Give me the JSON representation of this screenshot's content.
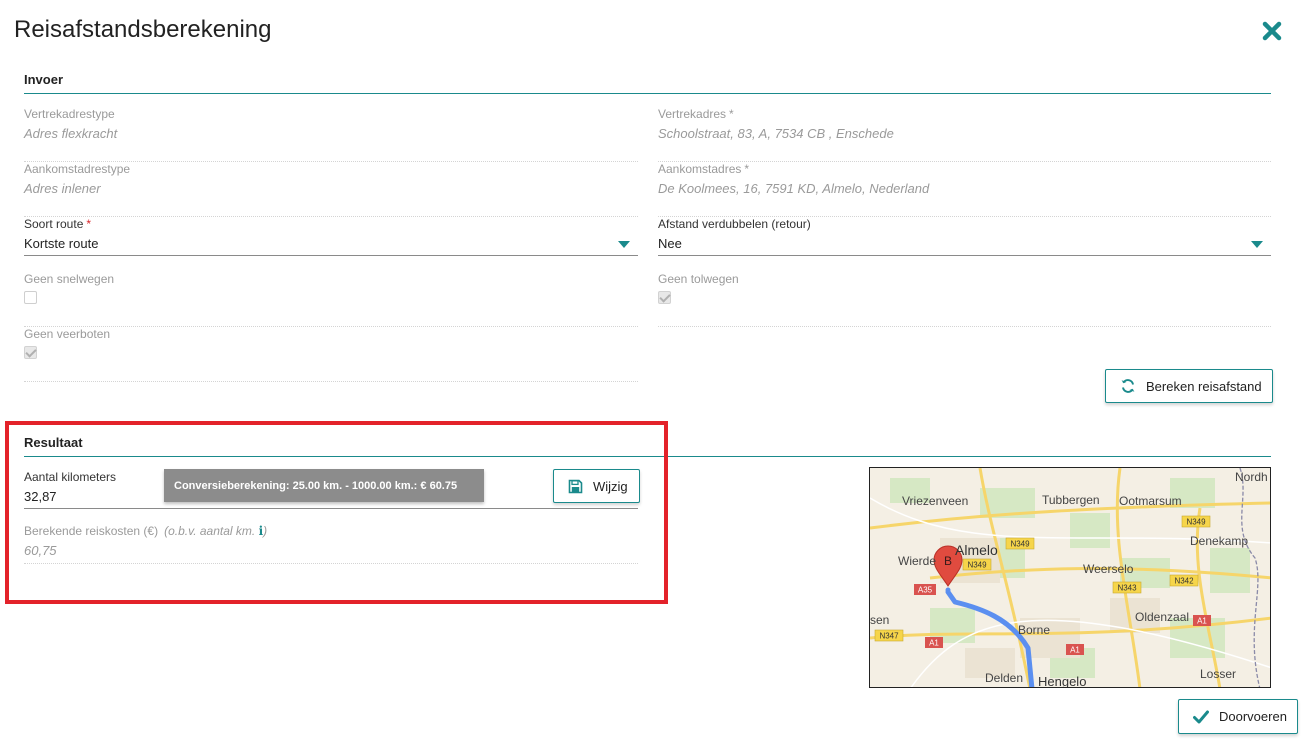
{
  "dialog": {
    "title": "Reisafstandsberekening"
  },
  "input_section": {
    "heading": "Invoer",
    "vertrek_type": {
      "label": "Vertrekadrestype",
      "value": "Adres flexkracht"
    },
    "vertrek_adres": {
      "label": "Vertrekadres",
      "required_mark": "*",
      "value": "Schoolstraat, 83, A, 7534 CB , Enschede"
    },
    "aankomst_type": {
      "label": "Aankomstadrestype",
      "value": "Adres inlener"
    },
    "aankomst_adres": {
      "label": "Aankomstadres",
      "required_mark": "*",
      "value": "De Koolmees, 16, 7591 KD, Almelo, Nederland"
    },
    "soort_route": {
      "label": "Soort route",
      "required_mark": "*",
      "selected": "Kortste route"
    },
    "afstand_verdubbelen": {
      "label": "Afstand verdubbelen (retour)",
      "selected": "Nee"
    },
    "geen_snelwegen": {
      "label": "Geen snelwegen",
      "checked": false
    },
    "geen_tolwegen": {
      "label": "Geen tolwegen",
      "checked": true
    },
    "geen_veerboten": {
      "label": "Geen veerboten",
      "checked": true
    },
    "calculate_button": {
      "label": "Bereken reisafstand",
      "icon": "refresh-icon"
    }
  },
  "result_section": {
    "heading": "Resultaat",
    "kilometers": {
      "label": "Aantal kilometers",
      "value": "32,87"
    },
    "tooltip": "Conversieberekening: 25.00 km. - 1000.00 km.: € 60.75",
    "edit_button": {
      "label": "Wijzig",
      "icon": "save-icon"
    },
    "reiskosten": {
      "label": "Berekende reiskosten (€)",
      "hint": "(o.b.v. aantal km.",
      "hint_close": ")",
      "value": "60,75"
    }
  },
  "map": {
    "marker_label": "B",
    "places": [
      "Nordh",
      "Vriezenveen",
      "Tubbergen",
      "Ootmarsum",
      "Almelo",
      "Wierde",
      "Denekamp",
      "Weerselo",
      "Oldenzaal",
      "Borne",
      "Delden",
      "Hengelo",
      "Losser",
      "sen"
    ],
    "road_labels": [
      "N349",
      "N349",
      "N349",
      "A35",
      "N343",
      "N342",
      "A1",
      "N347",
      "A1",
      "A1"
    ]
  },
  "footer": {
    "confirm_button": {
      "label": "Doorvoeren",
      "icon": "check-icon"
    }
  },
  "colors": {
    "accent": "#1a8a8c",
    "required": "#d9262b",
    "highlight": "#e3222a",
    "tooltip_bg": "#8c8c8c",
    "route": "#5b8ff0"
  }
}
